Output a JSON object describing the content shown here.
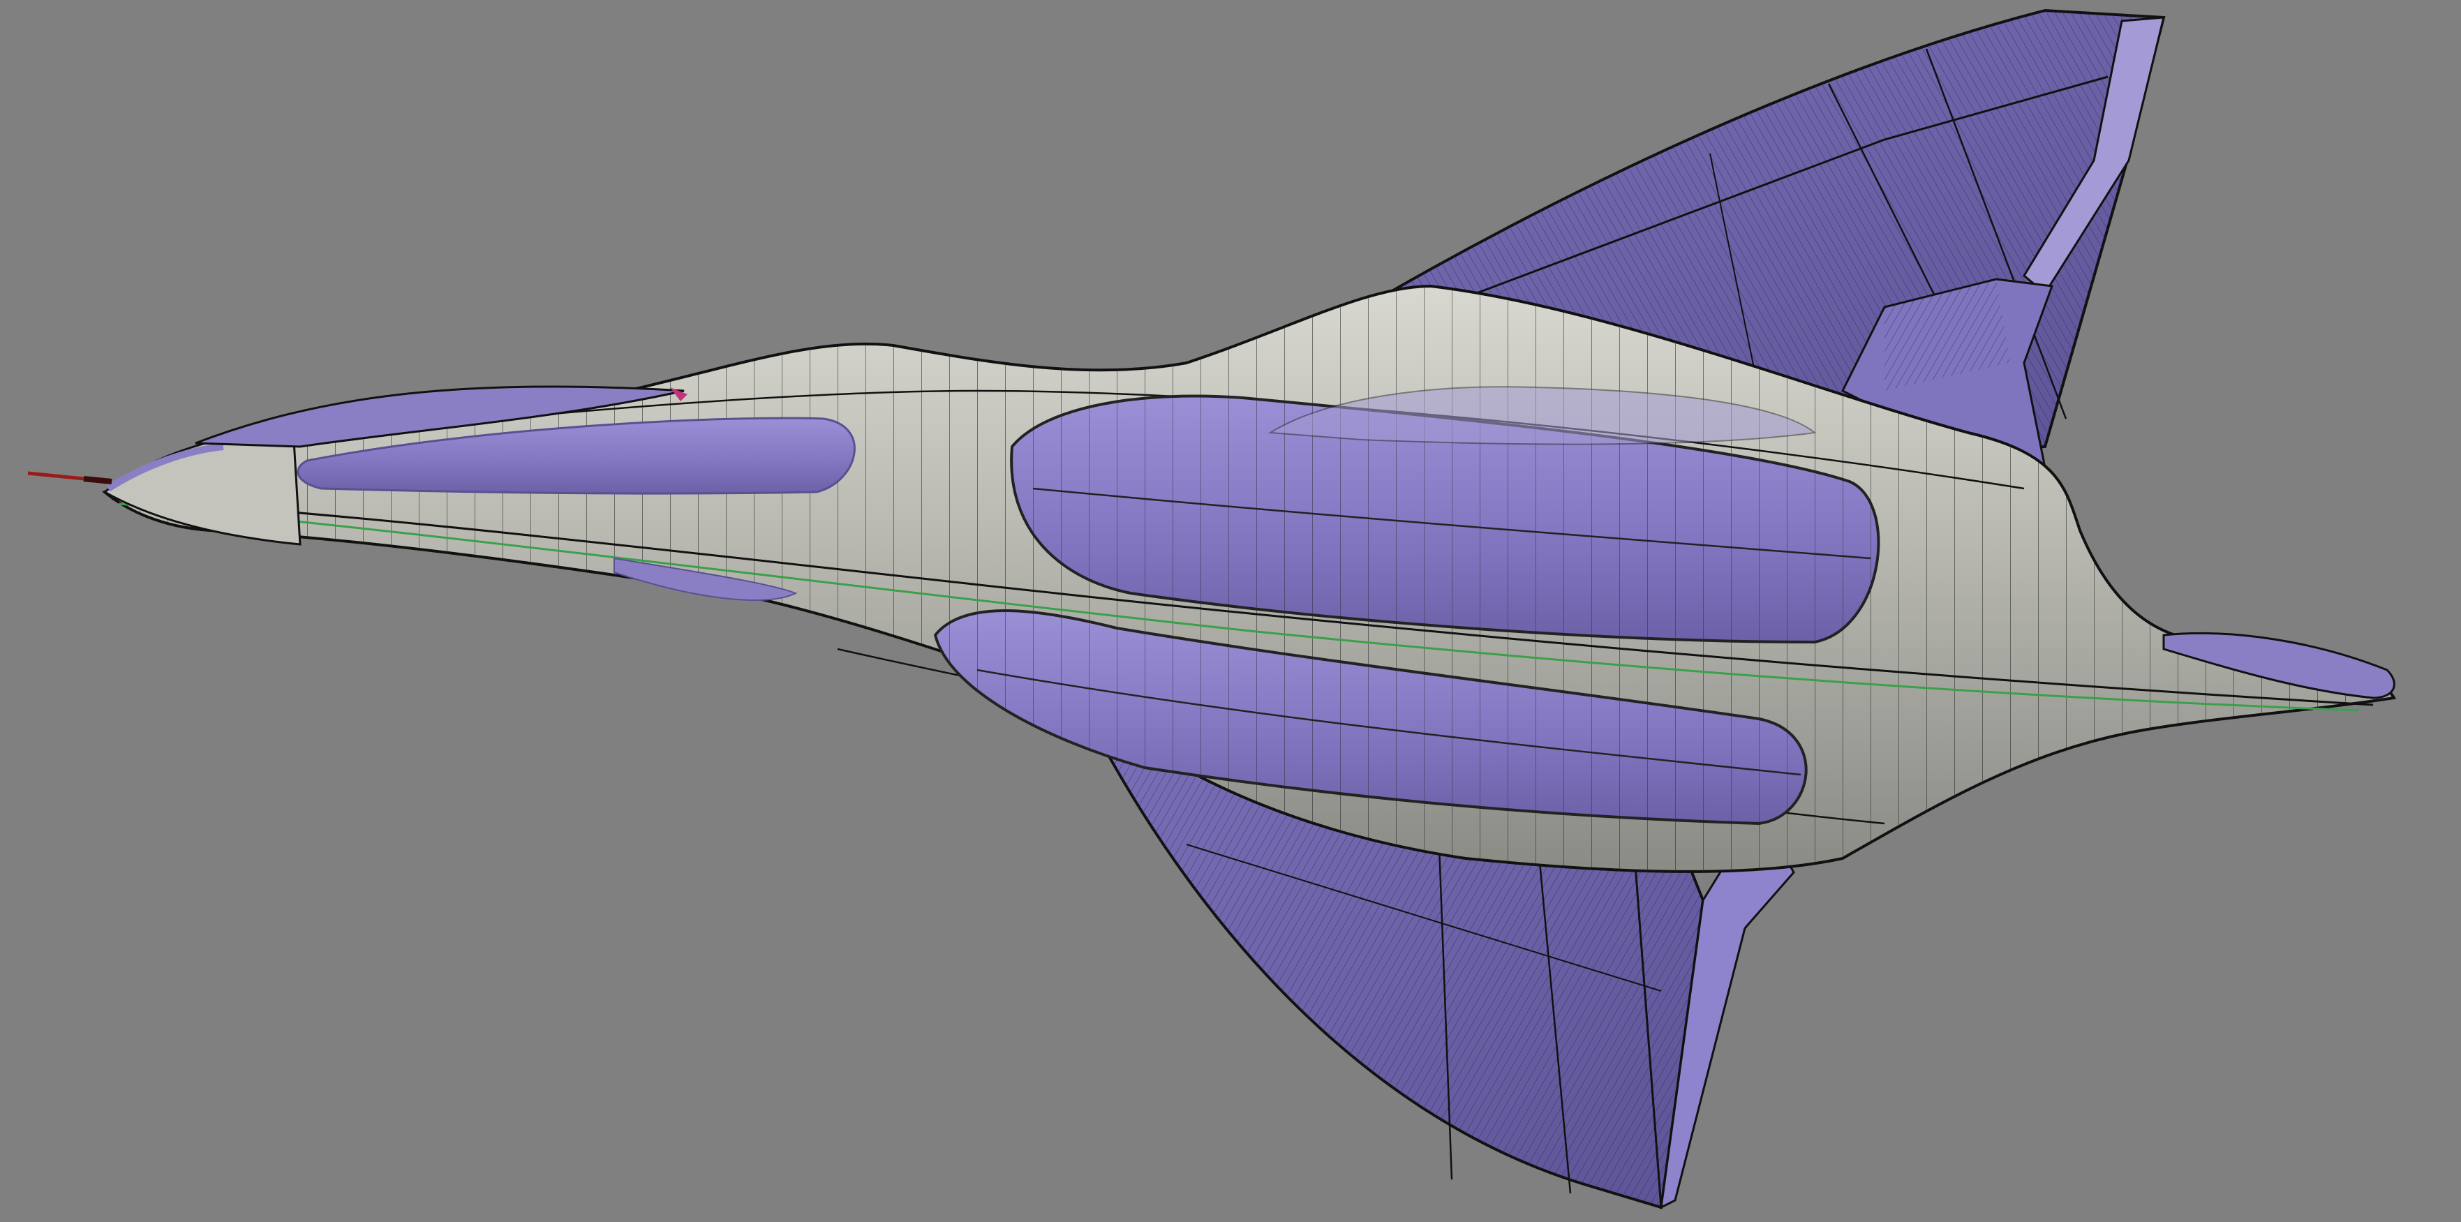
{
  "viewport": {
    "background_color": "#808080",
    "projection": "perspective"
  },
  "model": {
    "subject": "aircraft",
    "display_mode": "shaded-wireframe",
    "colors": {
      "surface_light": "#c9c9c2",
      "surface_mid": "#a9a9a2",
      "surface_dark": "#7d7d78",
      "highlight_purple": "#8a7fc4",
      "highlight_purple_dark": "#5f5698",
      "isoline": "#1a1a1a",
      "seam_green": "#3aa04a",
      "nose_probe_red": "#9a1b1b",
      "canopy_magenta": "#c0327a"
    }
  }
}
